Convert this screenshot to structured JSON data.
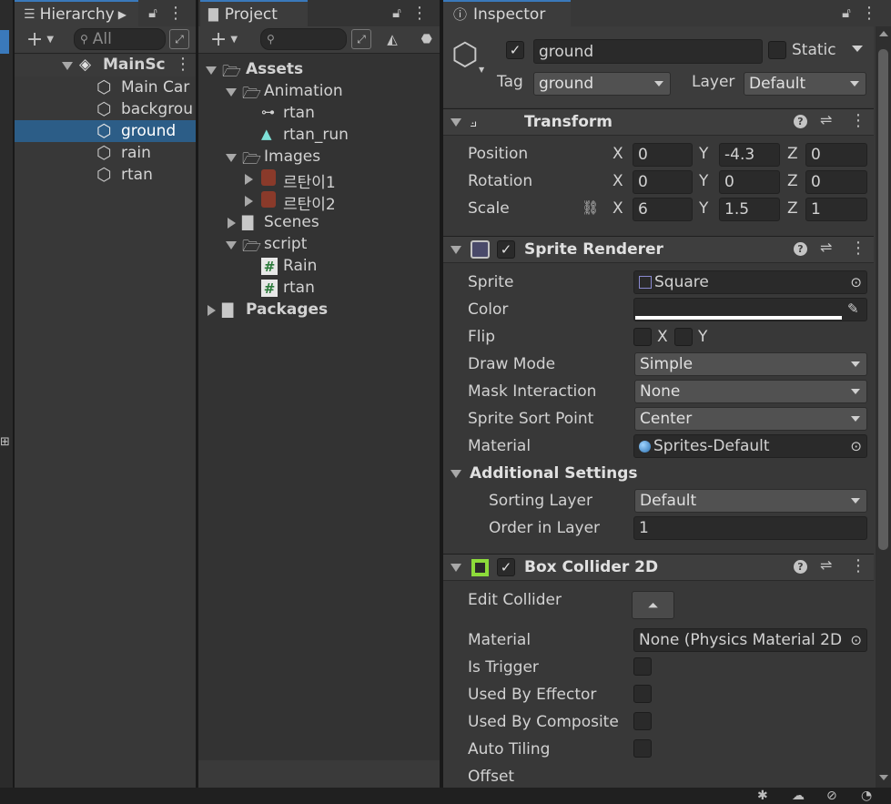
{
  "hierarchy": {
    "tab_label": "Hierarchy",
    "search_placeholder": "All",
    "scene_name": "MainSc",
    "items": [
      "Main Car",
      "backgrou",
      "ground",
      "rain",
      "rtan"
    ]
  },
  "project": {
    "tab_label": "Project",
    "tree": {
      "assets": "Assets",
      "animation": "Animation",
      "anim_rtan": "rtan",
      "anim_rtan_run": "rtan_run",
      "images": "Images",
      "img1": "르탄이1",
      "img2": "르탄이2",
      "scenes": "Scenes",
      "script": "script",
      "script_rain": "Rain",
      "script_rtan": "rtan",
      "packages": "Packages"
    }
  },
  "inspector": {
    "tab_label": "Inspector",
    "object_name": "ground",
    "static_label": "Static",
    "tag_label": "Tag",
    "tag_value": "ground",
    "layer_label": "Layer",
    "layer_value": "Default",
    "transform": {
      "title": "Transform",
      "position_label": "Position",
      "rotation_label": "Rotation",
      "scale_label": "Scale",
      "x": "X",
      "y": "Y",
      "z": "Z",
      "pos_x": "0",
      "pos_y": "-4.3",
      "pos_z": "0",
      "rot_x": "0",
      "rot_y": "0",
      "rot_z": "0",
      "scl_x": "6",
      "scl_y": "1.5",
      "scl_z": "1"
    },
    "sprite_renderer": {
      "title": "Sprite Renderer",
      "sprite_label": "Sprite",
      "sprite_value": "Square",
      "color_label": "Color",
      "color_value": "#ffffff",
      "flip_label": "Flip",
      "flip_x": "X",
      "flip_y": "Y",
      "draw_mode_label": "Draw Mode",
      "draw_mode_value": "Simple",
      "mask_label": "Mask Interaction",
      "mask_value": "None",
      "sort_point_label": "Sprite Sort Point",
      "sort_point_value": "Center",
      "material_label": "Material",
      "material_value": "Sprites-Default",
      "additional_label": "Additional Settings",
      "sorting_layer_label": "Sorting Layer",
      "sorting_layer_value": "Default",
      "order_label": "Order in Layer",
      "order_value": "1"
    },
    "box_collider": {
      "title": "Box Collider 2D",
      "edit_label": "Edit Collider",
      "material_label": "Material",
      "material_value": "None (Physics Material 2D",
      "trigger_label": "Is Trigger",
      "effector_label": "Used By Effector",
      "composite_label": "Used By Composite",
      "tiling_label": "Auto Tiling",
      "offset_label": "Offset"
    }
  },
  "colors": {
    "accent": "#3a79bb",
    "selected_row": "#2c5d87",
    "panel_bg": "#383838",
    "header_bg": "#3c3c3c",
    "field_bg": "#2a2a2a",
    "collider_green": "#8ddb3a"
  }
}
